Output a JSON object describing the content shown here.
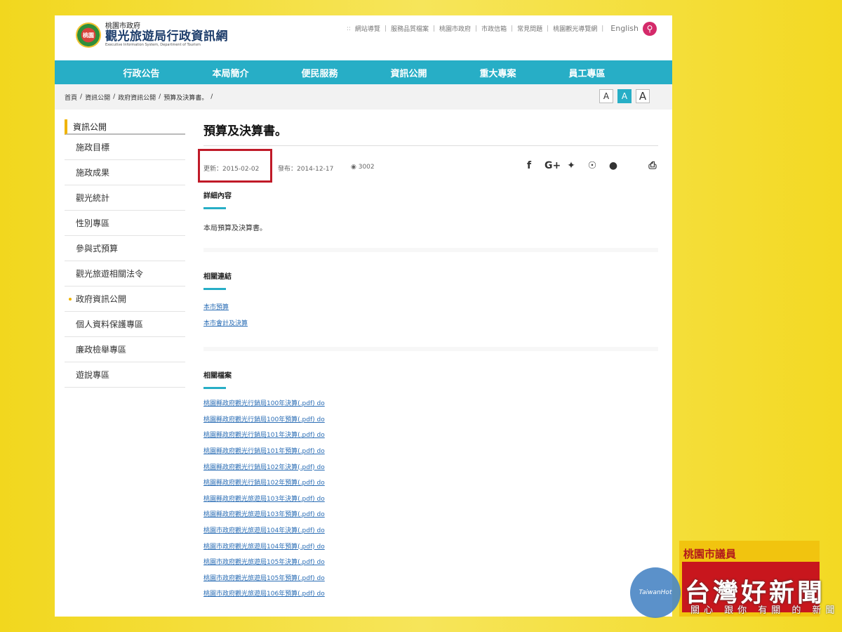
{
  "header": {
    "logo_seal": "桃園",
    "logo_line1": "桃園市政府",
    "logo_line2": "觀光旅遊局行政資訊網",
    "logo_line3": "Executive Information System, Department of Tourism",
    "top_links": [
      "網站導覽",
      "服務品質檔案",
      "桃園市政府",
      "市政信箱",
      "常見問題",
      "桃園觀光導覽網"
    ],
    "language": "English"
  },
  "nav": [
    "行政公告",
    "本局簡介",
    "便民服務",
    "資訊公開",
    "重大專案",
    "員工專區"
  ],
  "breadcrumb": [
    "首頁",
    "資訊公開",
    "政府資訊公開",
    "預算及決算書。"
  ],
  "font_sizes": [
    "A",
    "A",
    "A"
  ],
  "sidebar": {
    "heading": "資訊公開",
    "items": [
      "施政目標",
      "施政成果",
      "觀光統計",
      "性別專區",
      "參與式預算",
      "觀光旅遊相關法令",
      "政府資訊公開",
      "個人資料保護專區",
      "廉政檢舉專區",
      "遊說專區"
    ]
  },
  "main": {
    "title": "預算及決算書。",
    "updated": "更新：2015-02-02",
    "published": "發布：2014-12-17",
    "views": "3002",
    "detail_label": "詳細內容",
    "detail_text": "本局預算及決算書。",
    "related_links_label": "相關連結",
    "related_links": [
      "本市預算",
      "本市會計及決算"
    ],
    "related_files_label": "相關檔案",
    "related_files": [
      "桃園縣政府觀光行銷局100年決算(.pdf) do",
      "桃園縣政府觀光行銷局100年預算(.pdf) do",
      "桃園縣政府觀光行銷局101年決算(.pdf) do",
      "桃園縣政府觀光行銷局101年預算(.pdf) do",
      "桃園縣政府觀光行銷局102年決算(.pdf) do",
      "桃園縣政府觀光行銷局102年預算(.pdf) do",
      "桃園縣政府觀光旅遊局103年決算(.pdf) do",
      "桃園縣政府觀光旅遊局103年預算(.pdf) do",
      "桃園市政府觀光旅遊局104年決算(.pdf) do",
      "桃園市政府觀光旅遊局104年預算(.pdf) do",
      "桃園市政府觀光旅遊局105年決算(.pdf) do",
      "桃園市政府觀光旅遊局105年預算(.pdf) do",
      "桃園市政府觀光旅遊局106年預算(.pdf) do"
    ]
  },
  "overlay": {
    "ad_title": "桃園市議員",
    "watermark_circle": "TaiwanHot",
    "watermark_cn": "台灣好新聞",
    "watermark_sub": "關心 跟你 有關 的 新聞"
  },
  "colors": {
    "accent": "#27aec6",
    "highlight_box": "#c01a28",
    "search": "#d42a6a"
  }
}
